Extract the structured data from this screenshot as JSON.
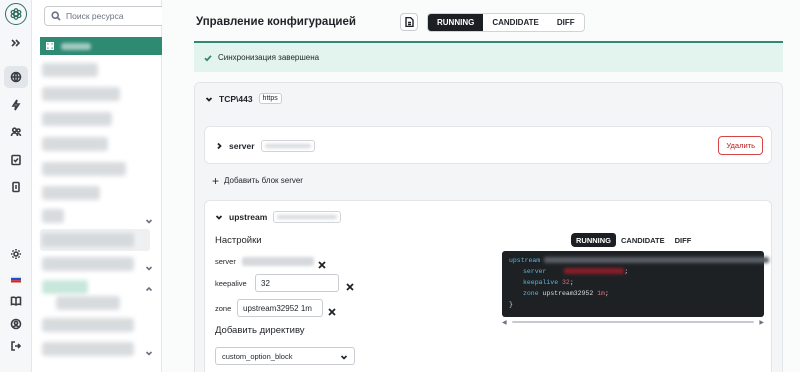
{
  "sidebar": {
    "search_placeholder": "Поиск ресурса",
    "icons": [
      "logo-icon",
      "expand-icon",
      "network-icon",
      "bolt-icon",
      "users-icon",
      "checklist-icon",
      "document-icon",
      "sun-icon",
      "flag-icon",
      "book-icon",
      "user-circle-icon",
      "logout-icon"
    ]
  },
  "header": {
    "title": "Управление конфигурацией",
    "tabs": [
      "RUNNING",
      "CANDIDATE",
      "DIFF"
    ],
    "active_tab": "RUNNING"
  },
  "banner": {
    "text": "Синхронизация завершена"
  },
  "listener": {
    "title": "TCP\\443",
    "tag": "https"
  },
  "server_block": {
    "label": "server",
    "delete_label": "Удалить"
  },
  "add_block": {
    "label": "Добавить блок server"
  },
  "upstream": {
    "label": "upstream",
    "settings_title": "Настройки",
    "fields": [
      {
        "label": "server",
        "value": ""
      },
      {
        "label": "keepalive",
        "value": "32"
      },
      {
        "label": "zone",
        "value": "upstream32952 1m"
      }
    ],
    "add_directive_title": "Добавить директиву",
    "directive_select": "custom_option_block",
    "preview_tabs": [
      "RUNNING",
      "CANDIDATE",
      "DIFF"
    ],
    "preview_active": "RUNNING",
    "code": {
      "line1": "upstream",
      "line2_key": "server",
      "line2_end": ";",
      "line3_key": "keepalive",
      "line3_val": "32",
      "line3_end": ";",
      "line4_key": "zone",
      "line4_mid": "upstream32952",
      "line4_val": "1m",
      "line4_end": ";",
      "line5": "}"
    }
  },
  "colors": {
    "accent": "#2e8a73",
    "banner_bg": "#e3f4ee",
    "danger": "#d64545",
    "code_bg": "#1e2124"
  }
}
